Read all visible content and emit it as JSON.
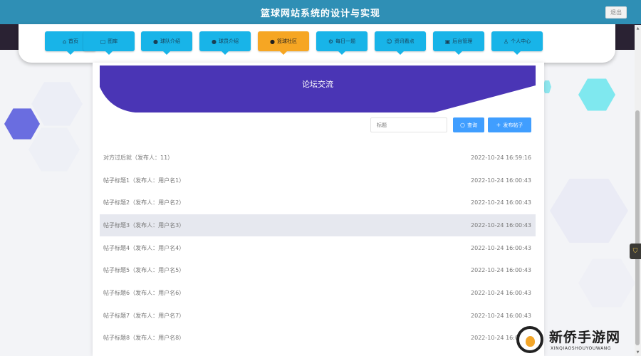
{
  "header": {
    "title": "篮球网站系统的设计与实现",
    "logout_label": "退出"
  },
  "nav": {
    "items": [
      {
        "label": "首页",
        "icon": "home-icon",
        "glyph": "⌂"
      },
      {
        "label": "图库",
        "icon": "image-icon",
        "glyph": "▢"
      },
      {
        "label": "球队介绍",
        "icon": "info-icon",
        "glyph": "●"
      },
      {
        "label": "球员介绍",
        "icon": "info-icon",
        "glyph": "●"
      },
      {
        "label": "篮球社区",
        "icon": "info-icon",
        "glyph": "●"
      },
      {
        "label": "每日一题",
        "icon": "gear-icon",
        "glyph": "⚙"
      },
      {
        "label": "资讯看点",
        "icon": "chat-icon",
        "glyph": "☺"
      },
      {
        "label": "后台管理",
        "icon": "admin-icon",
        "glyph": "▣"
      },
      {
        "label": "个人中心",
        "icon": "user-icon",
        "glyph": "♙"
      }
    ],
    "active_index": 4
  },
  "forum": {
    "banner_title": "论坛交流",
    "search_placeholder": "标题",
    "query_label": "查询",
    "publish_label": "发布帖子",
    "posts": [
      {
        "title": "对方过后就（发布人：11）",
        "time": "2022-10-24 16:59:16"
      },
      {
        "title": "帖子标题1（发布人：用户名1）",
        "time": "2022-10-24 16:00:43"
      },
      {
        "title": "帖子标题2（发布人：用户名2）",
        "time": "2022-10-24 16:00:43"
      },
      {
        "title": "帖子标题3（发布人：用户名3）",
        "time": "2022-10-24 16:00:43"
      },
      {
        "title": "帖子标题4（发布人：用户名4）",
        "time": "2022-10-24 16:00:43"
      },
      {
        "title": "帖子标题5（发布人：用户名5）",
        "time": "2022-10-24 16:00:43"
      },
      {
        "title": "帖子标题6（发布人：用户名6）",
        "time": "2022-10-24 16:00:43"
      },
      {
        "title": "帖子标题7（发布人：用户名7）",
        "time": "2022-10-24 16:00:43"
      },
      {
        "title": "帖子标题8（发布人：用户名8）",
        "time": "2022-10-24 16:00:43"
      }
    ],
    "highlighted_index": 3
  },
  "watermark": {
    "title": "新侨手游网",
    "subtitle": "XINQIAOSHOUYOUWANG"
  },
  "colors": {
    "header": "#2f8fb5",
    "nav_button": "#18b4e8",
    "nav_active": "#f6a623",
    "banner": "#4a35b5",
    "primary_button": "#409eff"
  }
}
